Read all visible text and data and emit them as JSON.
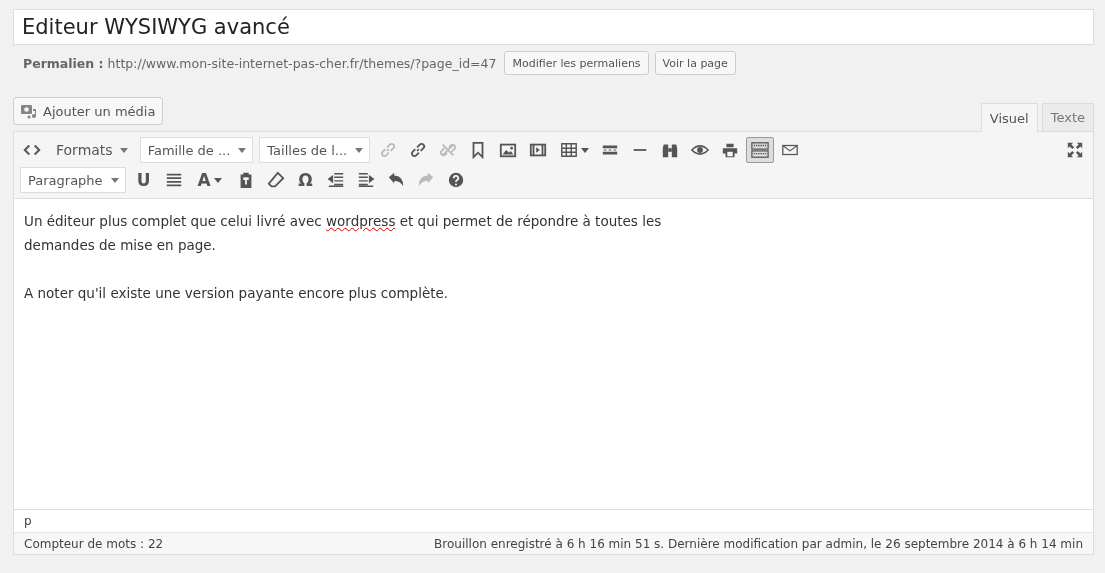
{
  "title_field": {
    "value": "Editeur WYSIWYG avancé"
  },
  "permalink": {
    "label": "Permalien :",
    "url": "http://www.mon-site-internet-pas-cher.fr/themes/?page_id=47",
    "buttons": [
      "Modifier les permaliens",
      "Voir la page"
    ]
  },
  "media_button": "Ajouter un média",
  "tabs": [
    {
      "label": "Visuel",
      "selected": true
    },
    {
      "label": "Texte",
      "selected": false
    }
  ],
  "toolbar_rows": [
    [
      {
        "kind": "icon",
        "disabled": false,
        "pressed": false
      },
      {
        "kind": "menu",
        "label": "Formats"
      },
      {
        "kind": "select",
        "value": "Famille de ..."
      },
      {
        "kind": "select",
        "value": "Tailles de l..."
      },
      {
        "kind": "icon",
        "disabled": true,
        "pressed": false
      },
      {
        "kind": "icon",
        "disabled": false,
        "pressed": false
      },
      {
        "kind": "icon",
        "disabled": true,
        "pressed": false
      },
      {
        "kind": "icon",
        "disabled": false,
        "pressed": false
      },
      {
        "kind": "icon",
        "disabled": false,
        "pressed": false
      },
      {
        "kind": "icon",
        "disabled": false,
        "pressed": false
      },
      {
        "kind": "icon",
        "disabled": false,
        "pressed": false,
        "caret": true
      },
      {
        "kind": "icon",
        "disabled": false,
        "pressed": false
      },
      {
        "kind": "icon",
        "disabled": false,
        "pressed": false
      },
      {
        "kind": "icon",
        "disabled": false,
        "pressed": false
      },
      {
        "kind": "icon",
        "disabled": false,
        "pressed": false
      },
      {
        "kind": "icon",
        "disabled": false,
        "pressed": false
      },
      {
        "kind": "icon",
        "disabled": false,
        "pressed": true
      },
      {
        "kind": "icon",
        "disabled": false,
        "pressed": false
      }
    ],
    [
      {
        "kind": "select",
        "value": "Paragraphe"
      },
      {
        "kind": "glyph",
        "glyph": "U",
        "disabled": false
      },
      {
        "kind": "icon",
        "disabled": false,
        "pressed": false
      },
      {
        "kind": "glyph",
        "glyph": "A",
        "disabled": false,
        "caret": true
      },
      {
        "kind": "icon",
        "disabled": false,
        "pressed": false
      },
      {
        "kind": "icon",
        "disabled": false,
        "pressed": false
      },
      {
        "kind": "glyph",
        "glyph": "Ω",
        "disabled": false
      },
      {
        "kind": "icon",
        "disabled": false,
        "pressed": false
      },
      {
        "kind": "icon",
        "disabled": false,
        "pressed": false
      },
      {
        "kind": "icon",
        "disabled": false,
        "pressed": false
      },
      {
        "kind": "icon",
        "disabled": true,
        "pressed": false
      },
      {
        "kind": "icon",
        "disabled": false,
        "pressed": false
      }
    ]
  ],
  "content": {
    "paragraphs": [
      [
        {
          "text": "Un éditeur plus complet que celui livré avec ",
          "misspelled": false
        },
        {
          "text": "wordpress",
          "misspelled": true
        },
        {
          "text": " et qui permet de répondre à toutes les demandes de mise en page.",
          "misspelled": false
        }
      ],
      [
        {
          "text": "A noter qu'il existe une version payante encore plus complète.",
          "misspelled": false
        }
      ]
    ]
  },
  "path": "p",
  "status": {
    "word_count": "Compteur de mots : 22",
    "saved": "Brouillon enregistré à 6 h 16 min 51 s. Dernière modification par admin, le 26 septembre 2014 à 6 h 14 min"
  }
}
